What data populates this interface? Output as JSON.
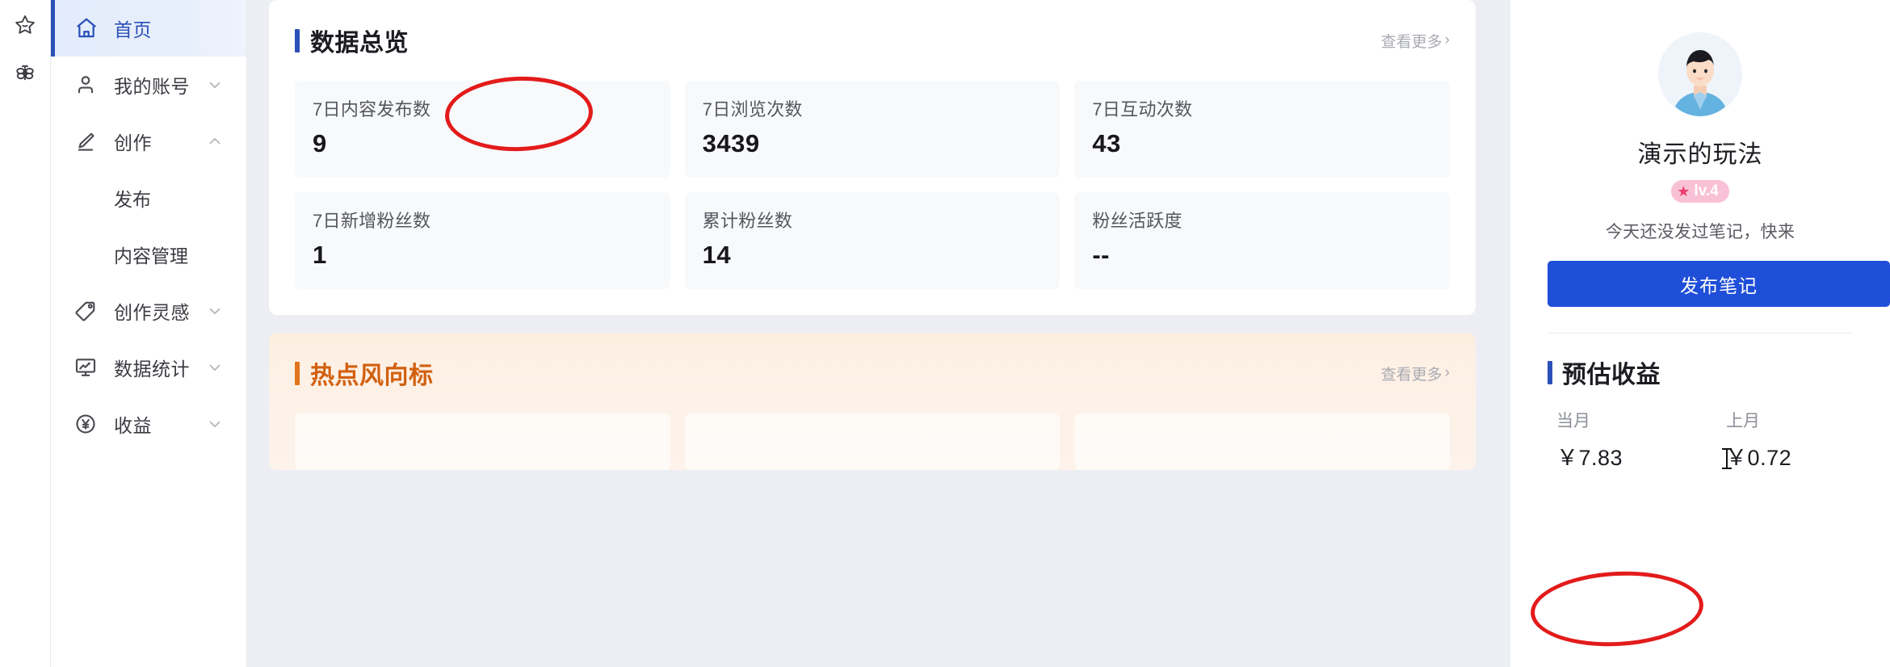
{
  "rail": {
    "icons": [
      {
        "name": "star-outline-icon"
      },
      {
        "name": "bee-outline-icon"
      }
    ]
  },
  "sidebar": {
    "items": [
      {
        "label": "首页",
        "icon": "home-icon",
        "active": true,
        "chevron": ""
      },
      {
        "label": "我的账号",
        "icon": "person-icon",
        "active": false,
        "chevron": "down"
      },
      {
        "label": "创作",
        "icon": "pencil-icon",
        "active": false,
        "chevron": "up"
      },
      {
        "label": "创作灵感",
        "icon": "tag-icon",
        "active": false,
        "chevron": "down"
      },
      {
        "label": "数据统计",
        "icon": "monitor-chart-icon",
        "active": false,
        "chevron": "down"
      },
      {
        "label": "收益",
        "icon": "yen-circle-icon",
        "active": false,
        "chevron": "down"
      }
    ],
    "sub_items": [
      {
        "label": "发布"
      },
      {
        "label": "内容管理"
      }
    ]
  },
  "overview": {
    "title": "数据总览",
    "more_label": "查看更多",
    "more_chevron": "›",
    "stats": [
      {
        "label": "7日内容发布数",
        "value": "9"
      },
      {
        "label": "7日浏览次数",
        "value": "3439"
      },
      {
        "label": "7日互动次数",
        "value": "43"
      },
      {
        "label": "7日新增粉丝数",
        "value": "1"
      },
      {
        "label": "累计粉丝数",
        "value": "14"
      },
      {
        "label": "粉丝活跃度",
        "value": "--"
      }
    ]
  },
  "hot": {
    "title": "热点风向标",
    "more_label": "查看更多",
    "more_chevron": "›"
  },
  "profile": {
    "username": "演示的玩法",
    "level_badge": "lv.4",
    "level_star": "★",
    "tip": "今天还没发过笔记，快来",
    "publish_button": "发布笔记"
  },
  "earnings": {
    "title": "预估收益",
    "items": [
      {
        "label": "当月",
        "value": "￥7.83"
      },
      {
        "label": "上月",
        "value": "￥0.72"
      }
    ]
  },
  "colors": {
    "accent_blue": "#2b50b8",
    "button_blue": "#1f4ed8",
    "hot_orange": "#d2600f",
    "annotation_red": "#e31b1b",
    "page_bg": "#eceef4"
  }
}
